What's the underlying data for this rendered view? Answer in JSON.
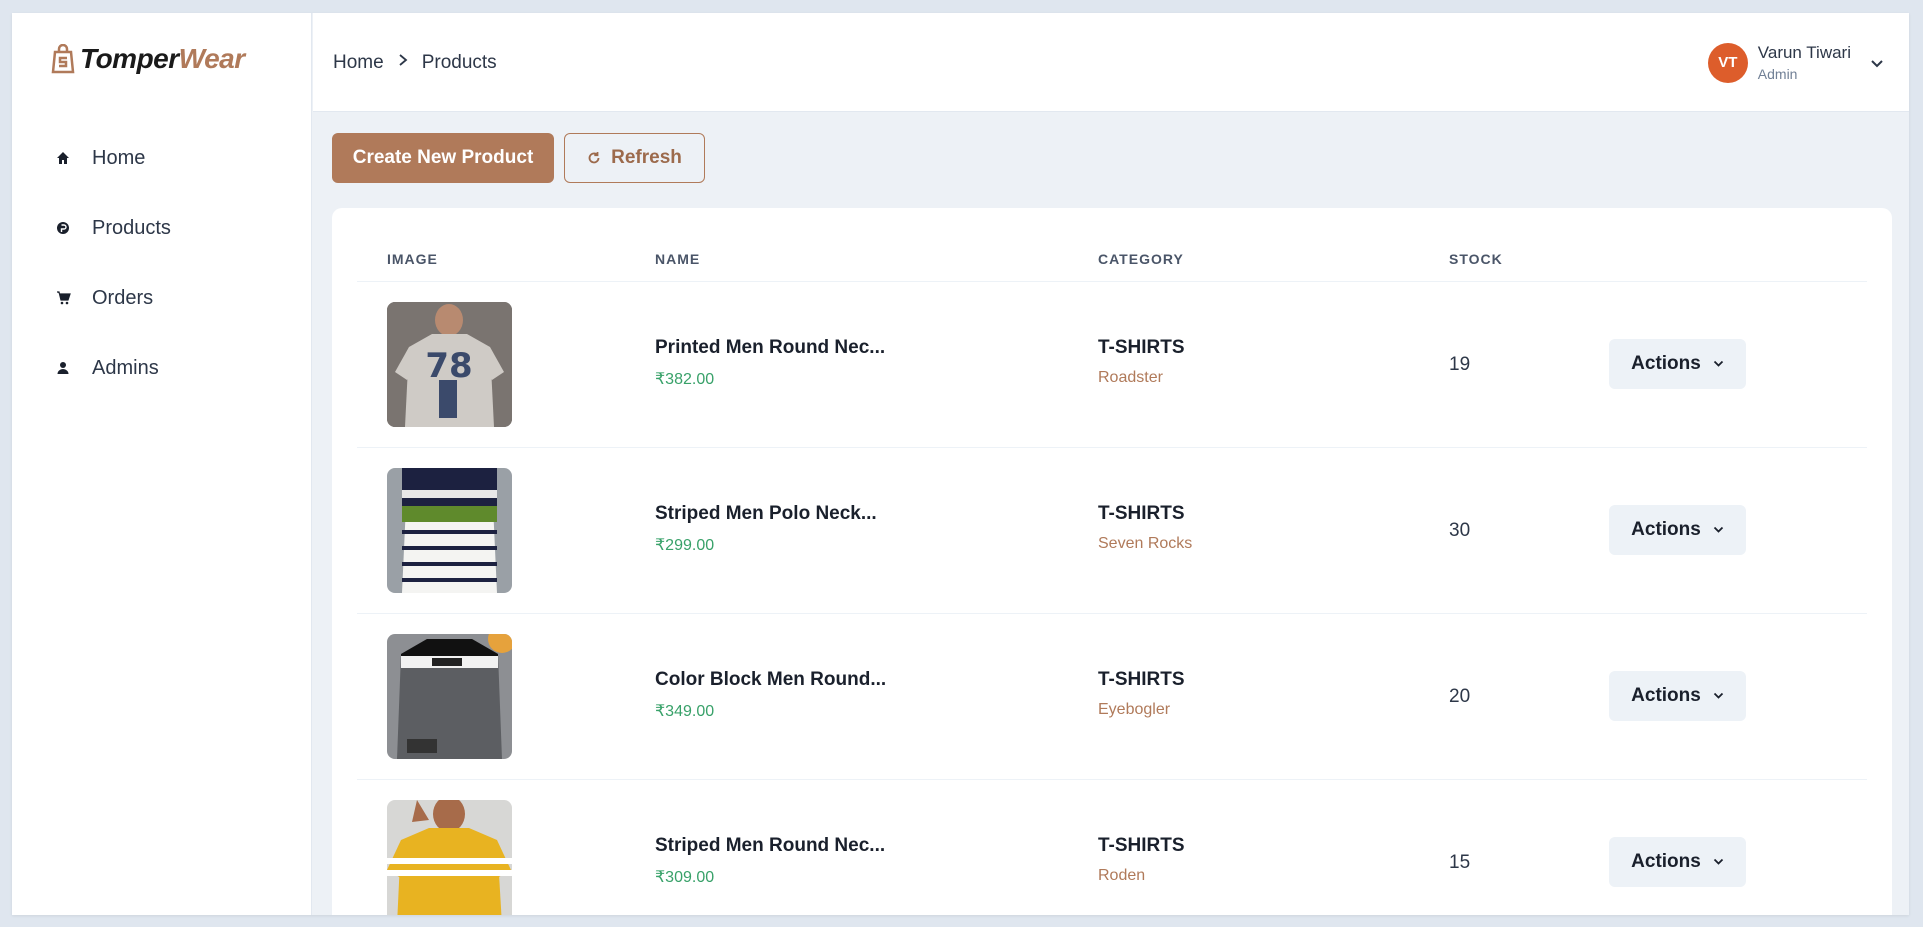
{
  "brand": {
    "part1": "Tomper",
    "part2": "Wear"
  },
  "sidebar": {
    "items": [
      {
        "label": "Home",
        "icon": "home-icon"
      },
      {
        "label": "Products",
        "icon": "product-icon"
      },
      {
        "label": "Orders",
        "icon": "cart-icon"
      },
      {
        "label": "Admins",
        "icon": "user-icon"
      }
    ]
  },
  "header": {
    "breadcrumb": [
      "Home",
      "Products"
    ],
    "user": {
      "initials": "VT",
      "name": "Varun Tiwari",
      "role": "Admin",
      "avatar_color": "#dd5d2b"
    }
  },
  "toolbar": {
    "create_label": "Create New Product",
    "refresh_label": "Refresh"
  },
  "table": {
    "headers": [
      "IMAGE",
      "NAME",
      "CATEGORY",
      "STOCK"
    ],
    "rows": [
      {
        "name": "Printed Men Round Nec...",
        "price": "₹382.00",
        "category": "T-SHIRTS",
        "brand": "Roadster",
        "stock": "19",
        "action": "Actions"
      },
      {
        "name": "Striped Men Polo Neck...",
        "price": "₹299.00",
        "category": "T-SHIRTS",
        "brand": "Seven Rocks",
        "stock": "30",
        "action": "Actions"
      },
      {
        "name": "Color Block Men Round...",
        "price": "₹349.00",
        "category": "T-SHIRTS",
        "brand": "Eyebogler",
        "stock": "20",
        "action": "Actions"
      },
      {
        "name": "Striped Men Round Nec...",
        "price": "₹309.00",
        "category": "T-SHIRTS",
        "brand": "Roden",
        "stock": "15",
        "action": "Actions"
      }
    ]
  },
  "colors": {
    "accent": "#b07a5a",
    "price": "#38a169",
    "background": "#edf1f6"
  }
}
